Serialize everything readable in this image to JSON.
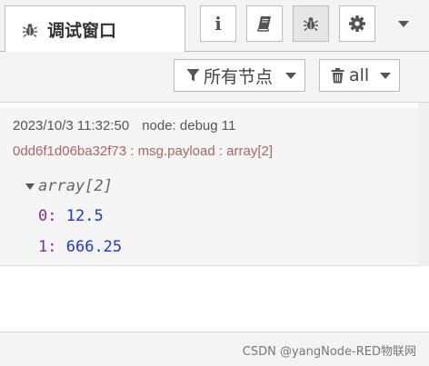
{
  "tab": {
    "label": "调试窗口",
    "icon": "bug-icon"
  },
  "sidebar_buttons": [
    {
      "name": "info",
      "icon": "info-icon"
    },
    {
      "name": "help",
      "icon": "book-icon"
    },
    {
      "name": "debug",
      "icon": "bug-icon",
      "selected": true
    },
    {
      "name": "config",
      "icon": "gear-icon"
    },
    {
      "name": "more",
      "icon": "chevron-down-icon"
    }
  ],
  "toolbar": {
    "filter_label": "所有节点",
    "clear_label": "all"
  },
  "message": {
    "timestamp": "2023/10/3 11:32:50",
    "node": "node: debug 11",
    "topic": "0dd6f1d06ba32f73 : msg.payload : array[2]",
    "type": "array[2]",
    "items": [
      {
        "key": "0",
        "value": "12.5"
      },
      {
        "key": "1",
        "value": "666.25"
      }
    ]
  },
  "footer": {
    "watermark": "CSDN @yangNode-RED物联网"
  },
  "colors": {
    "accent": "#792e90",
    "value": "#2033d6",
    "topic": "#aa6666"
  }
}
